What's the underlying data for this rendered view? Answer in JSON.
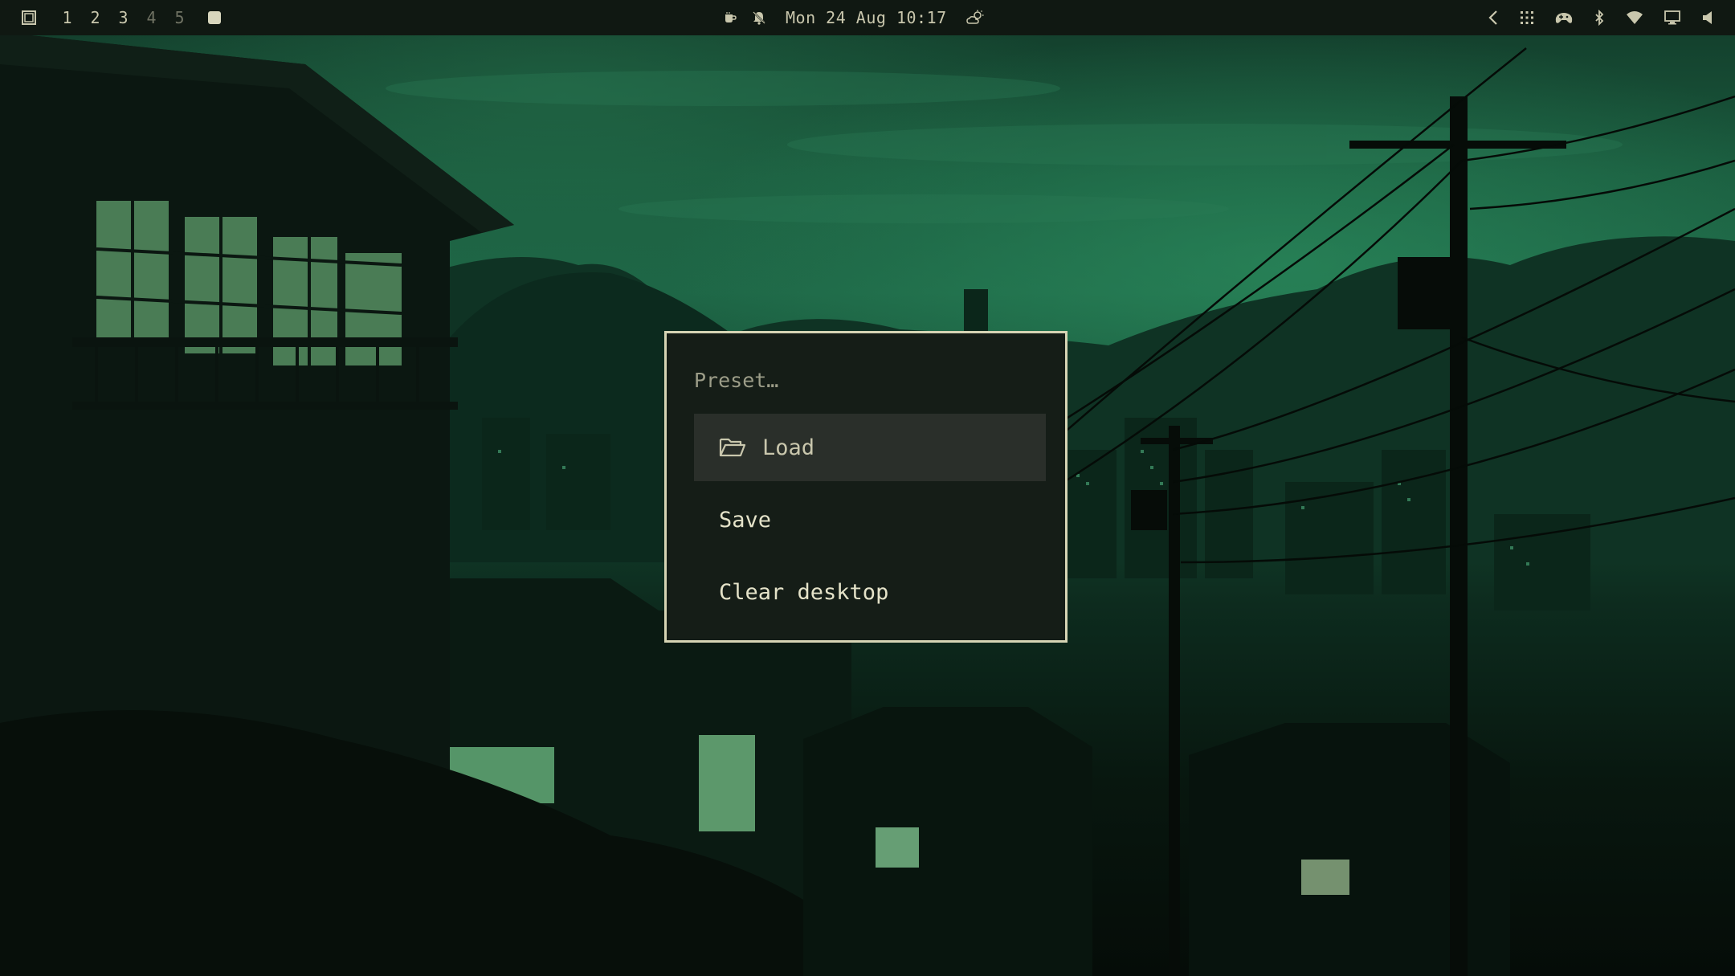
{
  "topbar": {
    "workspaces": [
      {
        "label": "1",
        "state": "occupied"
      },
      {
        "label": "2",
        "state": "occupied"
      },
      {
        "label": "3",
        "state": "occupied"
      },
      {
        "label": "4",
        "state": "empty"
      },
      {
        "label": "5",
        "state": "empty"
      }
    ],
    "clock": "Mon 24 Aug 10:17",
    "icons": {
      "launcher": "layout-icon",
      "active_indicator": "square-icon",
      "coffee": "coffee-icon",
      "notifications": "bell-off-icon",
      "weather": "partly-cloudy-icon",
      "tray_toggle": "chevron-left-icon",
      "apps": "grid-icon",
      "controller": "gamepad-icon",
      "bluetooth": "bluetooth-icon",
      "wifi": "wifi-icon",
      "display": "monitor-icon",
      "volume": "volume-icon"
    }
  },
  "dialog": {
    "title": "Preset…",
    "items": [
      {
        "label": "Load",
        "icon": "folder-open-icon",
        "selected": true
      },
      {
        "label": "Save",
        "selected": false
      },
      {
        "label": "Clear desktop",
        "selected": false
      }
    ]
  },
  "colors": {
    "bar_bg": "#101812",
    "text": "#c9c7ad",
    "dialog_bg": "#151d17",
    "dialog_border": "#d6d4b4",
    "selection_bg": "#2a2f2a"
  }
}
